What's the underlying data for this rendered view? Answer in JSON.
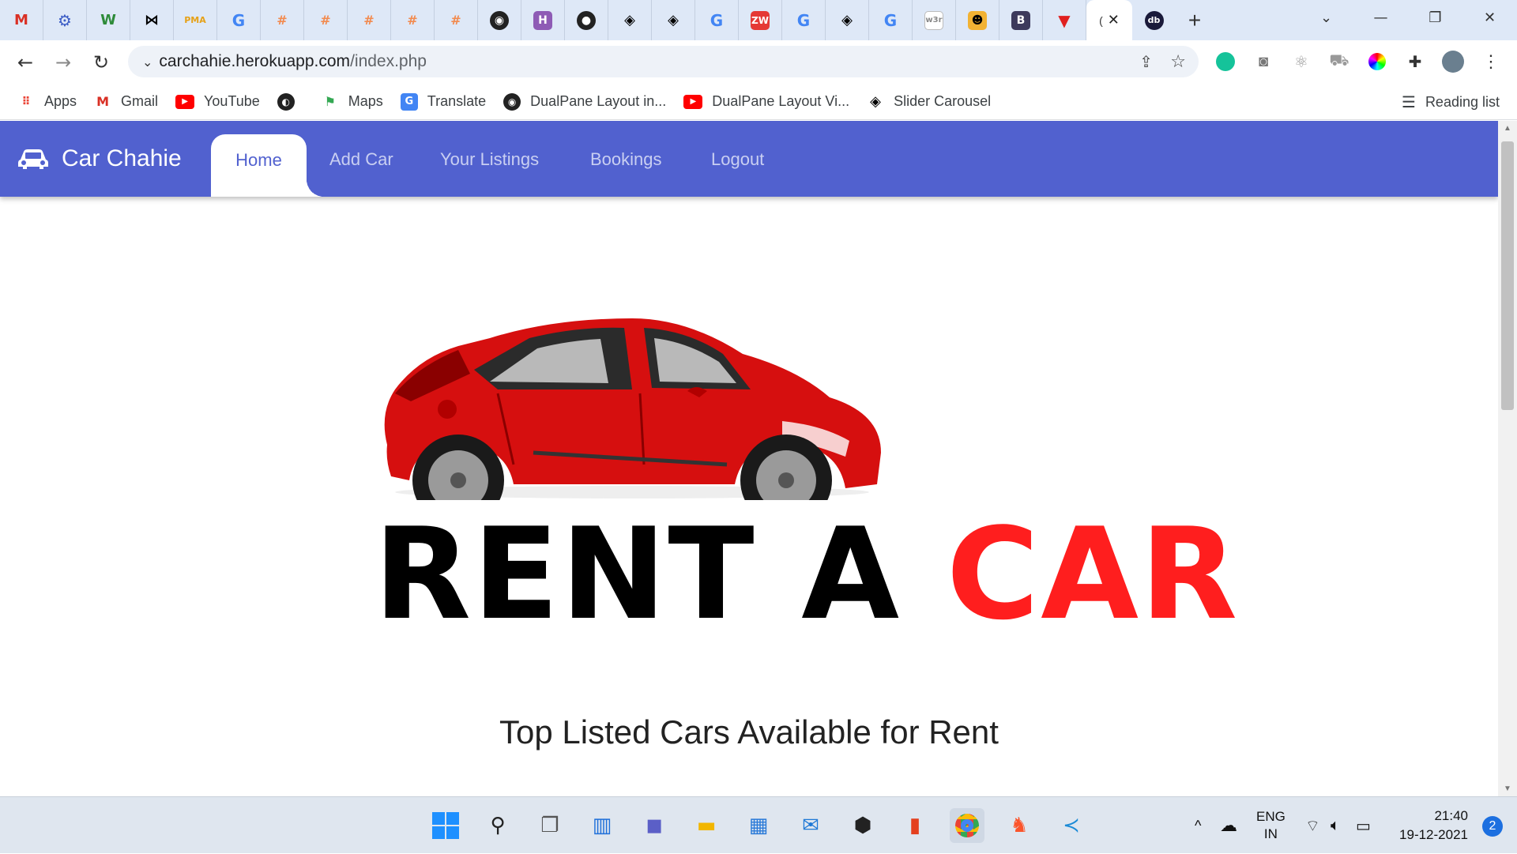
{
  "browser": {
    "tab_icons": [
      "gmail-icon",
      "settings-icon",
      "w-icon",
      "bow-icon",
      "pma-icon",
      "google-icon",
      "pdf-icon",
      "pdf-icon",
      "pdf-icon",
      "pdf-icon",
      "pdf-icon",
      "github-icon",
      "h-icon",
      "globe-icon",
      "codepen-icon",
      "codepen-icon",
      "google-icon",
      "zw-icon",
      "google-icon",
      "codepen-icon",
      "google-icon",
      "w3r-icon",
      "figure-icon",
      "bootstrap-icon",
      "vivaldi-icon",
      "active-tab",
      "db-icon"
    ],
    "address": {
      "domain": "carchahie.herokuapp.com",
      "path": "/index.php"
    },
    "bookmarks": [
      {
        "label": "Apps",
        "icon": "apps-icon"
      },
      {
        "label": "Gmail",
        "icon": "gmail-icon"
      },
      {
        "label": "YouTube",
        "icon": "youtube-icon"
      },
      {
        "label": "",
        "icon": "globe-icon"
      },
      {
        "label": "Maps",
        "icon": "maps-icon"
      },
      {
        "label": "Translate",
        "icon": "translate-icon"
      },
      {
        "label": "DualPane Layout in...",
        "icon": "github-icon"
      },
      {
        "label": "DualPane Layout Vi...",
        "icon": "youtube-icon"
      },
      {
        "label": "Slider Carousel",
        "icon": "codepen-icon"
      }
    ],
    "reading_list": "Reading list",
    "active_tab_text": "("
  },
  "site": {
    "brand": "Car Chahie",
    "nav": {
      "home": "Home",
      "add_car": "Add Car",
      "your_listings": "Your Listings",
      "bookings": "Bookings",
      "logout": "Logout"
    },
    "headline_black": "RENT A",
    "headline_red": "CAR",
    "section_title": "Top Listed Cars Available for Rent",
    "colors": {
      "navbar": "#5161cf",
      "accent_red": "#ff1e1e"
    }
  },
  "taskbar": {
    "lang_top": "ENG",
    "lang_bottom": "IN",
    "time": "21:40",
    "date": "19-12-2021",
    "notifications": "2"
  }
}
